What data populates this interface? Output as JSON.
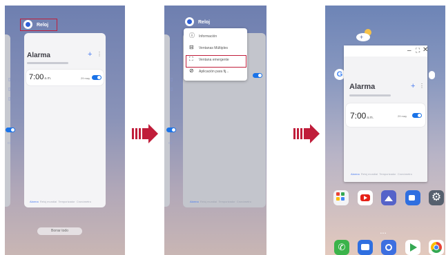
{
  "colors": {
    "accent": "#1a73e8",
    "highlight": "#c01d3a",
    "arrow": "#c01d3a"
  },
  "panel1": {
    "app_title": "Reloj",
    "card": {
      "title": "Alarma",
      "alarm_time": "7:00",
      "ampm": "a.m.",
      "days": "29 may",
      "tabs": [
        "Alarma",
        "Reloj mundial",
        "Temporizador",
        "Cronómetro"
      ]
    },
    "close_all": "Borrar todo"
  },
  "panel2": {
    "app_title": "Reloj",
    "menu": [
      {
        "icon": "info-icon",
        "label": "Información"
      },
      {
        "icon": "multi-window-icon",
        "label": "Ventanas Múltiples"
      },
      {
        "icon": "popup-window-icon",
        "label": "Ventana emergente"
      },
      {
        "icon": "pin-icon",
        "label": "Aplicación para fij..."
      }
    ],
    "tabs": [
      "Alarma",
      "Reloj mundial",
      "Temporizador",
      "Cronómetro"
    ]
  },
  "panel3": {
    "popup": {
      "title": "Alarma",
      "alarm_time": "7:00",
      "ampm": "a.m.",
      "days": "29 may",
      "tabs": [
        "Alarma",
        "Reloj mundial",
        "Temporizador",
        "Cronómetro"
      ]
    },
    "google": "G"
  }
}
